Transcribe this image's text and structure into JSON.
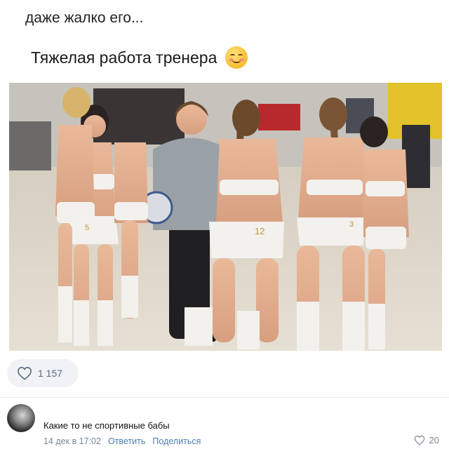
{
  "post": {
    "caption": "даже жалко его...",
    "title": "Тяжелая работа тренера",
    "title_emoji": "smiling-blush-emoji"
  },
  "image": {
    "jersey_numbers": [
      "5",
      "12",
      "3"
    ]
  },
  "reactions": {
    "likes_count": "1 157",
    "like_icon": "heart-outline-icon"
  },
  "comment": {
    "text": "Какие то не спортивные бабы",
    "timestamp": "14 дек в 17:02",
    "reply_label": "Ответить",
    "share_label": "Поделиться",
    "likes_count": "20",
    "like_icon": "heart-outline-icon"
  },
  "colors": {
    "accent_link": "#4c7fb5",
    "meta_gray": "#7a8796",
    "pill_bg": "#f0f2f5"
  }
}
